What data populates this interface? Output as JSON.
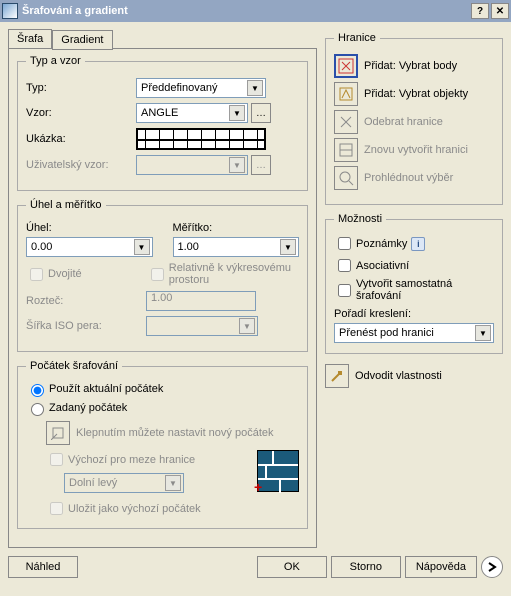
{
  "title": "Šrafování a gradient",
  "tabs": {
    "hatch": "Šrafa",
    "gradient": "Gradient"
  },
  "type_pattern": {
    "legend": "Typ a vzor",
    "type_label": "Typ:",
    "type_value": "Předdefinovaný",
    "pattern_label": "Vzor:",
    "pattern_value": "ANGLE",
    "sample_label": "Ukázka:",
    "custom_label": "Uživatelský vzor:"
  },
  "angle_scale": {
    "legend": "Úhel a měřítko",
    "angle_label": "Úhel:",
    "angle_value": "0.00",
    "scale_label": "Měřítko:",
    "scale_value": "1.00",
    "double_label": "Dvojité",
    "relative_label": "Relativně k výkresovému prostoru",
    "spacing_label": "Rozteč:",
    "spacing_value": "1.00",
    "iso_label": "Šířka ISO pera:"
  },
  "origin": {
    "legend": "Počátek šrafování",
    "use_current": "Použít aktuální počátek",
    "specified": "Zadaný počátek",
    "click_set": "Klepnutím můžete nastavit nový počátek",
    "default_bounds": "Výchozí pro meze hranice",
    "corner_value": "Dolní levý",
    "store_default": "Uložit jako výchozí počátek"
  },
  "boundaries": {
    "legend": "Hranice",
    "add_pick_points": "Přidat: Vybrat body",
    "add_select_objects": "Přidat: Vybrat objekty",
    "remove": "Odebrat hranice",
    "recreate": "Znovu vytvořit hranici",
    "view": "Prohlédnout výběr"
  },
  "options": {
    "legend": "Možnosti",
    "annotations": "Poznámky",
    "associative": "Asociativní",
    "separate": "Vytvořit samostatná šrafování",
    "draw_order_label": "Pořadí kreslení:",
    "draw_order_value": "Přenést pod hranici"
  },
  "inherit": "Odvodit vlastnosti",
  "footer": {
    "preview": "Náhled",
    "ok": "OK",
    "cancel": "Storno",
    "help": "Nápověda"
  }
}
